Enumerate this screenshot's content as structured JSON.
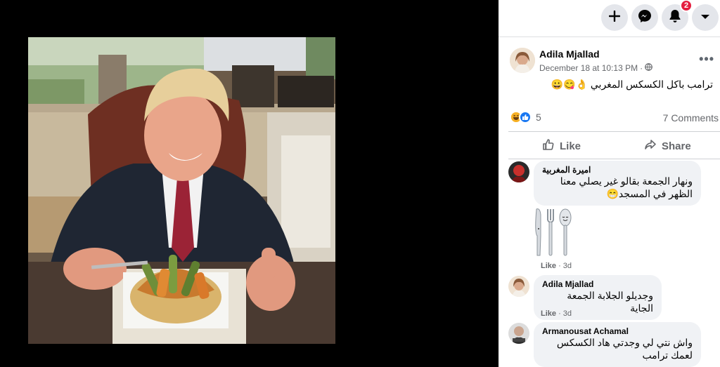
{
  "topbar": {
    "plus_icon": "plus-icon",
    "messenger_icon": "messenger-icon",
    "notifications_icon": "bell-icon",
    "notification_count": "2",
    "menu_icon": "caret-down-icon"
  },
  "post": {
    "author": "Adila Mjallad",
    "time": "December 18 at 10:13 PM",
    "separator": " · ",
    "privacy_icon": "globe-icon",
    "text": "ترامب باكل الكسكس المغربي 👌😋😀",
    "reaction_count": "5",
    "comments_count": "7 Comments",
    "like_label": "Like",
    "share_label": "Share"
  },
  "comments": [
    {
      "name": "اميرة المغربية",
      "text_line1": "ونهار الجمعة بقالو غير يصلي معنا",
      "text_line2": "الظهر في المسجد😁",
      "sticker": "cutlery-sticker",
      "like": "Like",
      "age": "3d"
    },
    {
      "name": "Adila Mjallad",
      "text_line1": "وجديلو الجلابة الجمعة الجاية",
      "like": "Like",
      "age": "3d"
    },
    {
      "name": "Armanousat Achamal",
      "text_line1": "واش نتي لي وجدتي هاد الكسكس",
      "text_line2": "لعمك ترامب"
    }
  ],
  "colors": {
    "accent": "#1877f2",
    "badge": "#e41e3f",
    "bubble": "#f0f2f5"
  }
}
